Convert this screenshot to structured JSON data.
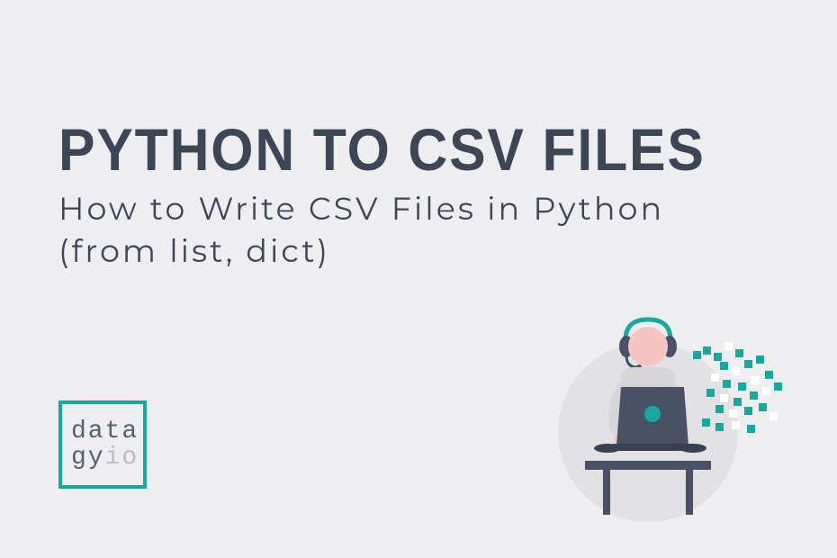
{
  "title": "PYTHON TO CSV FILES",
  "subtitle_line1": "How to Write CSV Files in Python",
  "subtitle_line2": "(from list, dict)",
  "logo": {
    "line1": "data",
    "line2_left": "gy",
    "line2_right": "io"
  },
  "colors": {
    "background": "#eeedef",
    "heading": "#3c4654",
    "accent_teal": "#17a9a0",
    "logo_text": "#546170",
    "logo_muted": "#bfbac0",
    "illustration_skin": "#f5c5c3",
    "illustration_dark": "#4a5167",
    "illustration_grey": "#d7d5d9"
  }
}
